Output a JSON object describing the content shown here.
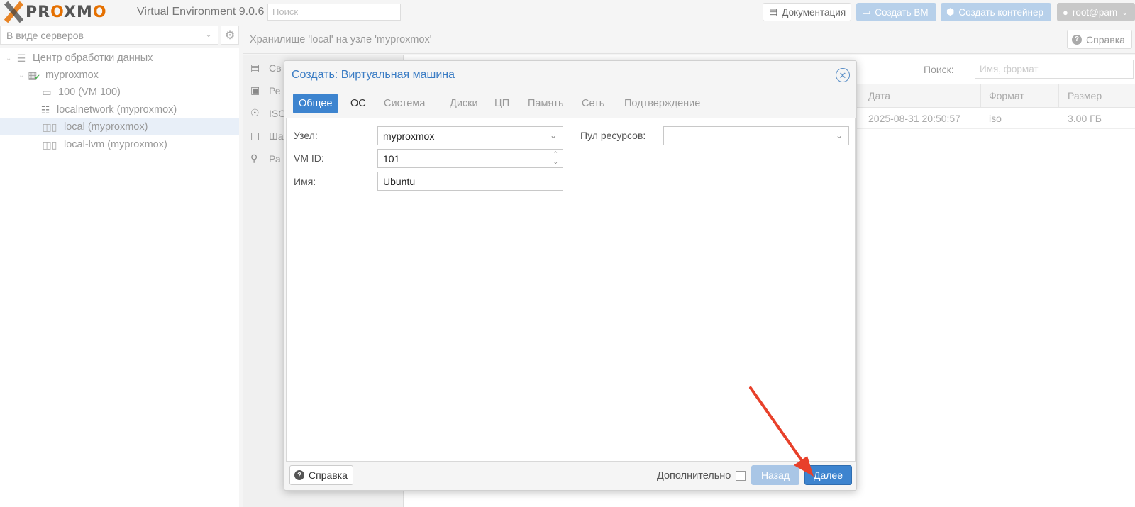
{
  "topbar": {
    "logo_text_1": "PR",
    "logo_text_o1": "O",
    "logo_text_2": "XM",
    "logo_text_o2": "O",
    "version": "Virtual Environment 9.0.6",
    "search_placeholder": "Поиск",
    "docs_label": "Документация",
    "create_vm_label": "Создать ВМ",
    "create_ct_label": "Создать контейнер",
    "user_label": "root@pam"
  },
  "sidebar": {
    "view_select": "В виде серверов",
    "tree": [
      {
        "label": "Центр обработки данных",
        "icon": "datacenter-icon"
      },
      {
        "label": "myproxmox",
        "icon": "node-icon"
      },
      {
        "label": "100 (VM 100)",
        "icon": "vm-icon"
      },
      {
        "label": "localnetwork (myproxmox)",
        "icon": "network-icon"
      },
      {
        "label": "local (myproxmox)",
        "icon": "storage-icon",
        "selected": true
      },
      {
        "label": "local-lvm (myproxmox)",
        "icon": "storage-icon"
      }
    ]
  },
  "content": {
    "title": "Хранилище 'local' на узле 'myproxmox'",
    "help_label": "Справка",
    "subnav": [
      "Св",
      "Ре",
      "ISC",
      "Ша",
      "Ра"
    ],
    "search_label": "Поиск:",
    "search_placeholder": "Имя, формат",
    "columns": [
      "Дата",
      "Формат",
      "Размер"
    ],
    "rows": [
      {
        "date": "2025-08-31 20:50:57",
        "format": "iso",
        "size": "3.00 ГБ"
      }
    ]
  },
  "dialog": {
    "title": "Создать: Виртуальная машина",
    "tabs": [
      "Общее",
      "ОС",
      "Система",
      "Диски",
      "ЦП",
      "Память",
      "Сеть",
      "Подтверждение"
    ],
    "active_tab": "Общее",
    "fields": {
      "node_label": "Узел:",
      "node_value": "myproxmox",
      "vmid_label": "VM ID:",
      "vmid_value": "101",
      "name_label": "Имя:",
      "name_value": "Ubuntu",
      "pool_label": "Пул ресурсов:",
      "pool_value": ""
    },
    "footer": {
      "help_label": "Справка",
      "advanced_label": "Дополнительно",
      "back_label": "Назад",
      "next_label": "Далее"
    }
  },
  "colors": {
    "accent": "#3d84cf",
    "accent_disabled": "#a9c6e6",
    "brand_orange": "#e57000",
    "annotation_arrow": "#e8402a"
  }
}
